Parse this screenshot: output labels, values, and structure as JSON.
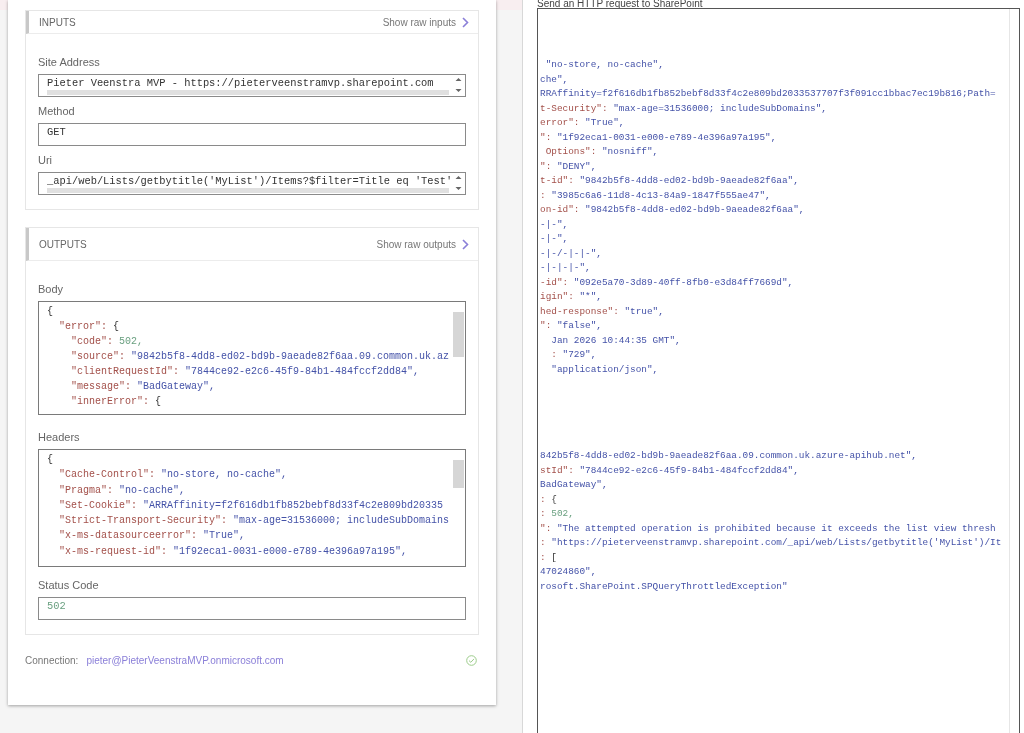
{
  "inputs": {
    "title": "INPUTS",
    "raw_link": "Show raw inputs",
    "fields": [
      {
        "label": "Site Address",
        "value": "Pieter Veenstra MVP - https://pieterveenstramvp.sharepoint.com",
        "kind": "scroll"
      },
      {
        "label": "Method",
        "value": "GET",
        "kind": "text"
      },
      {
        "label": "Uri",
        "value": "_api/web/Lists/getbytitle('MyList')/Items?$filter=Title eq 'Test'",
        "kind": "scroll"
      }
    ]
  },
  "outputs": {
    "title": "OUTPUTS",
    "raw_link": "Show raw outputs",
    "body": {
      "label": "Body",
      "lines": [
        {
          "value": "{",
          "kind": "brace"
        },
        {
          "key": "  \"error\":",
          "value": " {",
          "kind": "brace"
        },
        {
          "key": "    \"code\":",
          "value": " 502,",
          "kind": "number"
        },
        {
          "key": "    \"source\":",
          "value": " \"9842b5f8-4dd8-ed02-bd9b-9aeade82f6aa.09.common.uk.az",
          "kind": "string"
        },
        {
          "key": "    \"clientRequestId\":",
          "value": " \"7844ce92-e2c6-45f9-84b1-484fccf2dd84\",",
          "kind": "string"
        },
        {
          "key": "    \"message\":",
          "value": " \"BadGateway\",",
          "kind": "string"
        },
        {
          "key": "    \"innerError\":",
          "value": " {",
          "kind": "brace"
        }
      ]
    },
    "headers": {
      "label": "Headers",
      "lines": [
        {
          "value": "{",
          "kind": "brace"
        },
        {
          "key": "  \"Cache-Control\":",
          "value": " \"no-store, no-cache\",",
          "kind": "string"
        },
        {
          "key": "  \"Pragma\":",
          "value": " \"no-cache\",",
          "kind": "string"
        },
        {
          "key": "  \"Set-Cookie\":",
          "value": " \"ARRAffinity=f2f616db1fb852bebf8d33f4c2e809bd20335",
          "kind": "string"
        },
        {
          "key": "  \"Strict-Transport-Security\":",
          "value": " \"max-age=31536000; includeSubDomains",
          "kind": "string"
        },
        {
          "key": "  \"x-ms-datasourceerror\":",
          "value": " \"True\",",
          "kind": "string"
        },
        {
          "key": "  \"x-ms-request-id\":",
          "value": " \"1f92eca1-0031-e000-e789-4e396a97a195\",",
          "kind": "string"
        }
      ]
    },
    "status": {
      "label": "Status Code",
      "value": "502"
    }
  },
  "connection": {
    "label": "Connection:",
    "account": "pieter@PieterVeenstraMVP.onmicrosoft.com"
  },
  "detail": {
    "title": "Send an HTTP request to SharePoint",
    "blocks": [
      [
        {
          "value": " \"no-store, no-cache\",",
          "kind": "string"
        },
        {
          "value": "che\",",
          "kind": "string"
        },
        {
          "value": "RRAffinity=f2f616db1fb852bebf8d33f4c2e809bd2033537707f3f091cc1bbac7ec19b816;Path=",
          "kind": "string"
        },
        {
          "key": "t-Security\":",
          "value": " \"max-age=31536000; includeSubDomains\",",
          "kind": "string"
        },
        {
          "key": "error\":",
          "value": " \"True\",",
          "kind": "string"
        },
        {
          "key": "\":",
          "value": " \"1f92eca1-0031-e000-e789-4e396a97a195\",",
          "kind": "string"
        },
        {
          "key": " Options\":",
          "value": " \"nosniff\",",
          "kind": "string"
        },
        {
          "key": "\":",
          "value": " \"DENY\",",
          "kind": "string"
        },
        {
          "key": "t-id\":",
          "value": " \"9842b5f8-4dd8-ed02-bd9b-9aeade82f6aa\",",
          "kind": "string"
        },
        {
          "key": ":",
          "value": " \"3985c6a6-11d8-4c13-84a9-1847f555ae47\",",
          "kind": "string"
        },
        {
          "key": "on-id\":",
          "value": " \"9842b5f8-4dd8-ed02-bd9b-9aeade82f6aa\",",
          "kind": "string"
        },
        {
          "value": "-|-\",",
          "kind": "string"
        },
        {
          "value": "-|-\",",
          "kind": "string"
        },
        {
          "value": "-|-/-|-|-\",",
          "kind": "string"
        },
        {
          "value": "-|-|-|-\",",
          "kind": "string"
        },
        {
          "key": "-id\":",
          "value": " \"092e5a70-3d89-40ff-8fb0-e3d84ff7669d\",",
          "kind": "string"
        },
        {
          "key": "igin\":",
          "value": " \"*\",",
          "kind": "string"
        },
        {
          "key": "hed-response\":",
          "value": " \"true\",",
          "kind": "string"
        },
        {
          "key": "\":",
          "value": " \"false\",",
          "kind": "string"
        },
        {
          "value": "  Jan 2026 10:44:35 GMT\",",
          "kind": "string"
        },
        {
          "key": "  :",
          "value": " \"729\",",
          "kind": "string"
        },
        {
          "value": "  \"application/json\",",
          "kind": "string"
        }
      ],
      [
        {
          "value": "842b5f8-4dd8-ed02-bd9b-9aeade82f6aa.09.common.uk.azure-apihub.net\",",
          "kind": "string"
        },
        {
          "key": "stId\":",
          "value": " \"7844ce92-e2c6-45f9-84b1-484fccf2dd84\",",
          "kind": "string"
        },
        {
          "value": "BadGateway\",",
          "kind": "string"
        },
        {
          "key": ":",
          "value": " {",
          "kind": "brace"
        },
        {
          "key": ":",
          "value": " 502,",
          "kind": "number"
        },
        {
          "key": "\":",
          "value": " \"The attempted operation is prohibited because it exceeds the list view thresh",
          "kind": "string"
        },
        {
          "key": ":",
          "value": " \"https://pieterveenstramvp.sharepoint.com/_api/web/Lists/getbytitle('MyList')/It",
          "kind": "string"
        },
        {
          "key": ":",
          "value": " [",
          "kind": "brace"
        },
        {
          "value": "47024860\",",
          "kind": "string"
        },
        {
          "value": "rosoft.SharePoint.SPQueryThrottledException\"",
          "kind": "string"
        }
      ]
    ]
  }
}
